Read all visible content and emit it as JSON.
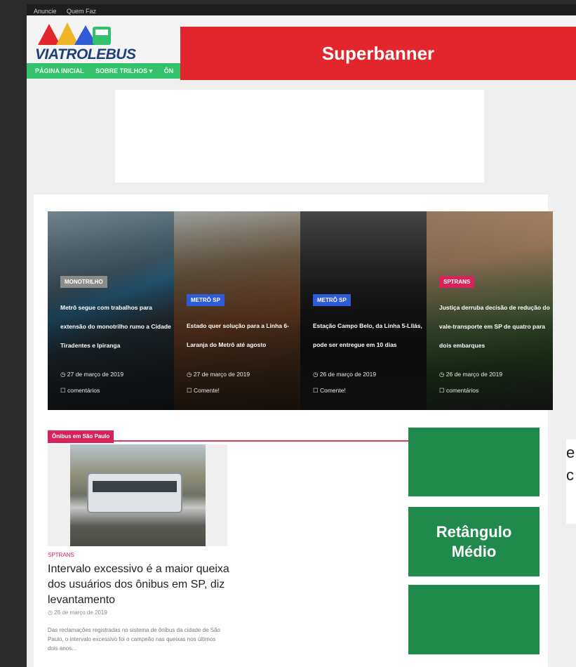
{
  "topbar": {
    "links": [
      "Anuncie",
      "Quem Faz"
    ]
  },
  "logo": {
    "text": "VIATROLEBUS"
  },
  "nav": {
    "items": [
      "PÁGINA INICIAL",
      "SOBRE TRILHOS ▾",
      "ÔN"
    ]
  },
  "ads": {
    "superbanner": "Superbanner",
    "medium_rectangle_line1": "Retângulo",
    "medium_rectangle_line2": "Médio",
    "side_peek_1": "e",
    "side_peek_2": "c"
  },
  "slides": [
    {
      "tag": "MONOTRILHO",
      "tag_color": "#8c8c8c",
      "title": "Metrô segue com trabalhos para extensão do monotrilho rumo a Cidade Tiradentes e Ipiranga",
      "date": "27 de março de 2019",
      "comments": "comentários"
    },
    {
      "tag": "METRÔ SP",
      "tag_color": "#2e5bd6",
      "title": "Estado quer solução para a Linha 6-Laranja do Metrô até agosto",
      "date": "27 de março de 2019",
      "comments": "Comente!"
    },
    {
      "tag": "METRÔ SP",
      "tag_color": "#2e5bd6",
      "title": "Estação Campo Belo, da Linha 5-Lilás, pode ser entregue em 10 dias",
      "date": "26 de março de 2019",
      "comments": "Comente!"
    },
    {
      "tag": "SPTRANS",
      "tag_color": "#d6245b",
      "title": "Justiça derruba decisão de redução do vale-transporte em SP de quatro para dois embarques",
      "date": "26 de março de 2019",
      "comments": "comentários"
    }
  ],
  "section": {
    "heading": "Ônibus em São Paulo"
  },
  "article": {
    "category": "SPTRANS",
    "title": "Intervalo excessivo é a maior queixa dos usuários dos ônibus em SP, diz levantamento",
    "date": "26 de março de 2019",
    "excerpt": "Das reclamações registradas no sistema de ônibus da cidade de São Paulo, o intervalo excessivo foi o campeão nas queixas nos últimos dois anos..."
  }
}
